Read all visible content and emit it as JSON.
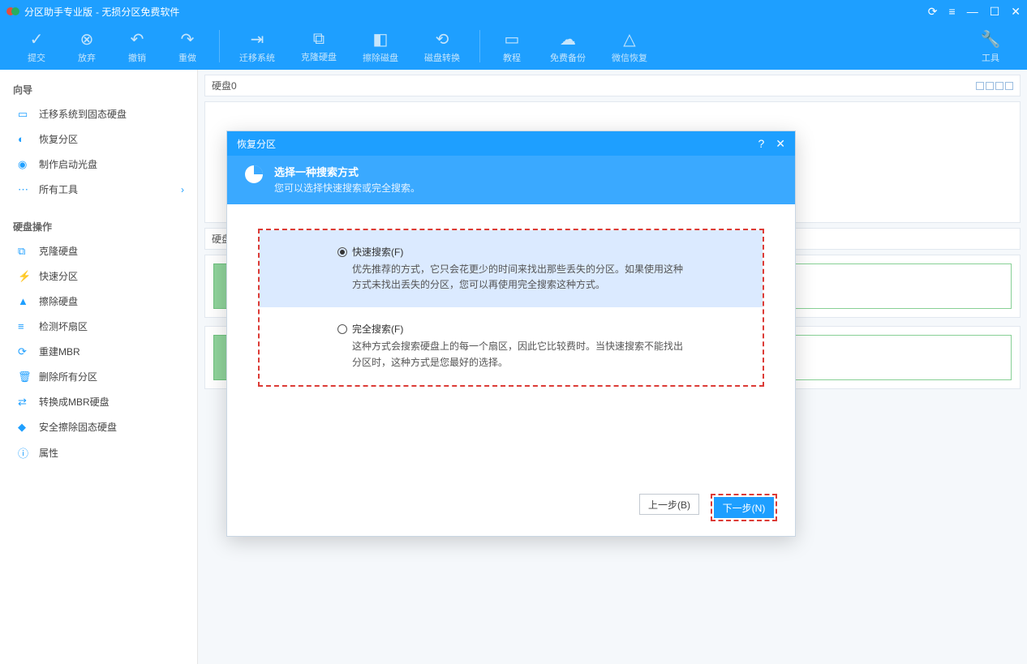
{
  "titlebar": {
    "app": "分区助手专业版",
    "sub": "无损分区免费软件"
  },
  "toolbar": {
    "commit": "提交",
    "discard": "放弃",
    "undo": "撤销",
    "redo": "重做",
    "migrate": "迁移系统",
    "clone": "克隆硬盘",
    "wipe": "擦除磁盘",
    "convert": "磁盘转换",
    "tutorial": "教程",
    "backup": "免费备份",
    "wechat": "微信恢复",
    "tools": "工具"
  },
  "sidebar": {
    "wizard_h": "向导",
    "wizard": {
      "migrate_ssd": "迁移系统到固态硬盘",
      "recover": "恢复分区",
      "bootdisc": "制作启动光盘",
      "alltools": "所有工具"
    },
    "diskops_h": "硬盘操作",
    "diskops": {
      "clone": "克隆硬盘",
      "quick": "快速分区",
      "wipe": "擦除硬盘",
      "badsector": "检测坏扇区",
      "rebuildmbr": "重建MBR",
      "deleteall": "删除所有分区",
      "convertmbr": "转换成MBR硬盘",
      "securewipe": "安全擦除固态硬盘",
      "props": "属性"
    }
  },
  "content": {
    "disk0": "硬盘0",
    "ops_h": "硬盘"
  },
  "modal": {
    "title": "恢复分区",
    "header_title": "选择一种搜索方式",
    "header_sub": "您可以选择快速搜索或完全搜索。",
    "opt1_title": "快速搜索(F)",
    "opt1_desc": "优先推荐的方式，它只会花更少的时间来找出那些丢失的分区。如果使用这种方式未找出丢失的分区，您可以再使用完全搜索这种方式。",
    "opt2_title": "完全搜索(F)",
    "opt2_desc": "这种方式会搜索硬盘上的每一个扇区，因此它比较费时。当快速搜索不能找出分区时，这种方式是您最好的选择。",
    "prev": "上一步(B)",
    "next": "下一步(N)"
  }
}
